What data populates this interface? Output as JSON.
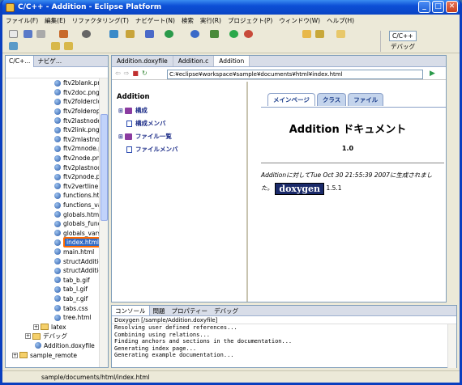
{
  "window": {
    "title": "C/C++ - Addition - Eclipse Platform"
  },
  "menu": [
    "ファイル(F)",
    "編集(E)",
    "リファクタリング(T)",
    "ナビゲート(N)",
    "検索",
    "実行(R)",
    "プロジェクト(P)",
    "ウィンドウ(W)",
    "ヘルプ(H)"
  ],
  "perspectives": {
    "cpp": "C/C++",
    "debug": "デバッグ"
  },
  "left_panel": {
    "tabs": [
      "C/C+...",
      "ナビゲ..."
    ],
    "tree": [
      {
        "label": "ftv2blank.png",
        "type": "file",
        "indent": 60
      },
      {
        "label": "ftv2doc.png",
        "type": "file",
        "indent": 60
      },
      {
        "label": "ftv2folderclosed.png",
        "type": "file",
        "indent": 60
      },
      {
        "label": "ftv2folderopen.png",
        "type": "file",
        "indent": 60
      },
      {
        "label": "ftv2lastnode.png",
        "type": "file",
        "indent": 60
      },
      {
        "label": "ftv2link.png",
        "type": "file",
        "indent": 60
      },
      {
        "label": "ftv2mlastnode.png",
        "type": "file",
        "indent": 60
      },
      {
        "label": "ftv2mnode.png",
        "type": "file",
        "indent": 60
      },
      {
        "label": "ftv2node.png",
        "type": "file",
        "indent": 60
      },
      {
        "label": "ftv2plastnode.png",
        "type": "file",
        "indent": 60
      },
      {
        "label": "ftv2pnode.png",
        "type": "file",
        "indent": 60
      },
      {
        "label": "ftv2vertline.png",
        "type": "file",
        "indent": 60
      },
      {
        "label": "functions.html",
        "type": "file",
        "indent": 60
      },
      {
        "label": "functions_vars.html",
        "type": "file",
        "indent": 60
      },
      {
        "label": "globals.html",
        "type": "file",
        "indent": 60
      },
      {
        "label": "globals_func.html",
        "type": "file",
        "indent": 60
      },
      {
        "label": "globals_vars.html",
        "type": "file",
        "indent": 60
      },
      {
        "label": "index.html",
        "type": "file",
        "indent": 60,
        "selected": true
      },
      {
        "label": "main.html",
        "type": "file",
        "indent": 60
      },
      {
        "label": "structAddition.html",
        "type": "file",
        "indent": 60
      },
      {
        "label": "structAddition-members.html",
        "type": "file",
        "indent": 60
      },
      {
        "label": "tab_b.gif",
        "type": "file",
        "indent": 60
      },
      {
        "label": "tab_l.gif",
        "type": "file",
        "indent": 60
      },
      {
        "label": "tab_r.gif",
        "type": "file",
        "indent": 60
      },
      {
        "label": "tabs.css",
        "type": "file",
        "indent": 60
      },
      {
        "label": "tree.html",
        "type": "file",
        "indent": 60
      },
      {
        "label": "latex",
        "type": "folder",
        "indent": 34
      },
      {
        "label": "デバッグ",
        "type": "folder",
        "indent": 24
      },
      {
        "label": "Addition.doxyfile",
        "type": "file",
        "indent": 36
      },
      {
        "label": "sample_remote",
        "type": "folder",
        "indent": 8
      }
    ]
  },
  "editor": {
    "tabs": [
      "Addition.doxyfile",
      "Addition.c",
      "Addition"
    ],
    "url": "C:¥eclipse¥workspace¥sample¥documents¥html¥index.html",
    "nav_title": "Addition",
    "nav_items": [
      {
        "label": "構成",
        "icon": "book"
      },
      {
        "label": "構成メンバ",
        "icon": "doc"
      },
      {
        "label": "ファイル一覧",
        "icon": "book"
      },
      {
        "label": "ファイルメンバ",
        "icon": "doc"
      }
    ],
    "doc_tabs": [
      "メインページ",
      "クラス",
      "ファイル"
    ],
    "doc_title": "Addition ドキュメント",
    "doc_version": "1.0",
    "generated_line1": "Additionに対してTue Oct 30 21:55:39 2007に生成されまし",
    "generated_line2": "た。",
    "doxygen_logo": "doxygen",
    "doxygen_version": "1.5.1"
  },
  "console": {
    "tabs": [
      "コンソール",
      "問題",
      "プロパティー",
      "デバッグ"
    ],
    "header": "Doxygen [/sample/Addition.doxyfile]",
    "lines": [
      "Resolving user defined references...",
      "Combining using relations...",
      "Finding anchors and sections in the documentation...",
      "Generating index page...",
      "Generating example documentation..."
    ]
  },
  "status": "sample/documents/html/index.html",
  "colors": {
    "title_bar": "#0a44c4",
    "selection": "#316ac5",
    "highlight_border": "#ff6a00"
  }
}
